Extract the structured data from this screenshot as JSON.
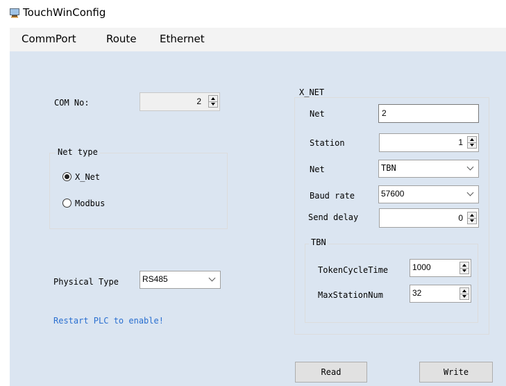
{
  "window": {
    "title": "TouchWinConfig"
  },
  "menu": {
    "items": [
      "CommPort",
      "Route",
      "Ethernet"
    ]
  },
  "left": {
    "com_no_label": "COM No:",
    "com_no_value": "2",
    "net_type": {
      "label": "Net type",
      "options": [
        "X_Net",
        "Modbus"
      ],
      "selected": "X_Net"
    },
    "physical_type_label": "Physical Type",
    "physical_type_value": "RS485",
    "restart_note": "Restart PLC to enable!",
    "restart_note_color": "#2a6fd0"
  },
  "xnet": {
    "group_label": "X_NET",
    "net_label": "Net",
    "net_value": "2",
    "station_label": "Station",
    "station_value": "1",
    "net2_label": "Net",
    "net2_value": "TBN",
    "baud_label": "Baud rate",
    "baud_value": "57600",
    "send_delay_label": "Send delay",
    "send_delay_value": "0",
    "tbn": {
      "group_label": "TBN",
      "token_label": "TokenCycleTime",
      "token_value": "1000",
      "maxstation_label": "MaxStationNum",
      "maxstation_value": "32"
    }
  },
  "buttons": {
    "read": "Read",
    "write": "Write"
  }
}
